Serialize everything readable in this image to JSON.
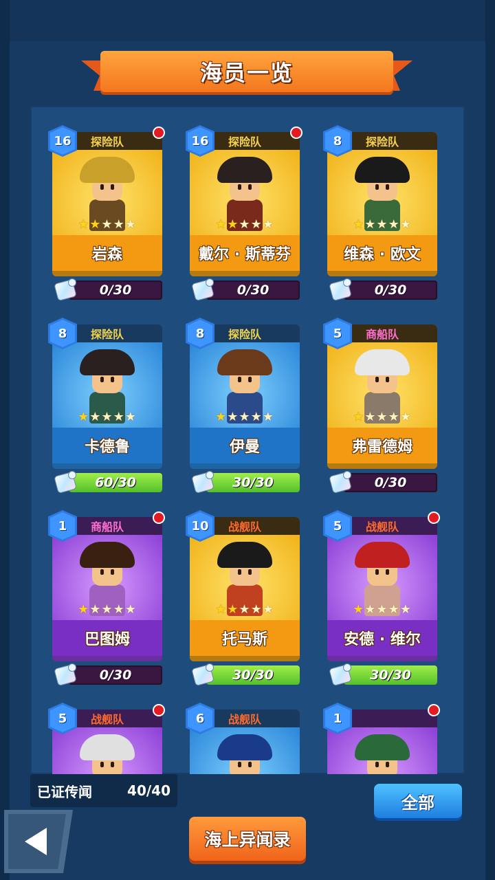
{
  "title": "海员一览",
  "crew": [
    {
      "level": "16",
      "team": "探险队",
      "team_type": "explore",
      "name": "岩森",
      "stars": 2,
      "progress_text": "0/30",
      "progress": 0,
      "color": "orange",
      "alert": true,
      "hat": "#c9a02a",
      "body": "#6a4a20"
    },
    {
      "level": "16",
      "team": "探险队",
      "team_type": "explore",
      "name": "戴尔 · 斯蒂芬",
      "stars": 2,
      "progress_text": "0/30",
      "progress": 0,
      "color": "orange",
      "alert": true,
      "hat": "#2a2020",
      "body": "#7a2a1a"
    },
    {
      "level": "8",
      "team": "探险队",
      "team_type": "explore",
      "name": "维森 · 欧文",
      "stars": 1,
      "progress_text": "0/30",
      "progress": 0,
      "color": "orange",
      "alert": false,
      "hat": "#1a1a1a",
      "body": "#3a6a3a"
    },
    {
      "level": "8",
      "team": "探险队",
      "team_type": "explore",
      "name": "卡德鲁",
      "stars": 1,
      "progress_text": "60/30",
      "progress": 1,
      "color": "blue",
      "alert": false,
      "hat": "#2a2020",
      "body": "#2a5a4a"
    },
    {
      "level": "8",
      "team": "探险队",
      "team_type": "explore",
      "name": "伊曼",
      "stars": 1,
      "progress_text": "30/30",
      "progress": 1,
      "color": "blue",
      "alert": false,
      "hat": "#6a3a1a",
      "body": "#2a4a8a"
    },
    {
      "level": "5",
      "team": "商船队",
      "team_type": "ship",
      "name": "弗雷德姆",
      "stars": 1,
      "progress_text": "0/30",
      "progress": 0,
      "color": "orange",
      "alert": false,
      "hat": "#e8e8e8",
      "body": "#8a7a6a"
    },
    {
      "level": "1",
      "team": "商船队",
      "team_type": "ship",
      "name": "巴图姆",
      "stars": 1,
      "progress_text": "0/30",
      "progress": 0,
      "color": "purple",
      "alert": true,
      "hat": "#3a2010",
      "body": "#a060c0"
    },
    {
      "level": "10",
      "team": "战舰队",
      "team_type": "war",
      "name": "托马斯",
      "stars": 2,
      "progress_text": "30/30",
      "progress": 1,
      "color": "orange",
      "alert": false,
      "hat": "#1a1a1a",
      "body": "#c04020"
    },
    {
      "level": "5",
      "team": "战舰队",
      "team_type": "war",
      "name": "安德 · 维尔",
      "stars": 1,
      "progress_text": "30/30",
      "progress": 1,
      "color": "purple",
      "alert": true,
      "hat": "#c02020",
      "body": "#d0a090"
    },
    {
      "level": "5",
      "team": "战舰队",
      "team_type": "war",
      "name": "",
      "stars": 0,
      "progress_text": "",
      "progress": 0,
      "color": "purple",
      "alert": true,
      "hat": "#e0e0e0",
      "body": "#6a8a3a"
    },
    {
      "level": "6",
      "team": "战舰队",
      "team_type": "war",
      "name": "",
      "stars": 0,
      "progress_text": "",
      "progress": 0,
      "color": "blue",
      "alert": false,
      "hat": "#1a3a8a",
      "body": "#5a3a2a"
    },
    {
      "level": "1",
      "team": "",
      "team_type": "",
      "name": "",
      "stars": 0,
      "progress_text": "",
      "progress": 0,
      "color": "purple",
      "alert": true,
      "hat": "#2a6a3a",
      "body": "#3a2a1a"
    }
  ],
  "footer": {
    "found_label": "已证传闻",
    "found_count": "40/40",
    "all_button": "全部",
    "tales_button": "海上异闻录"
  },
  "icons": {
    "back": "back-arrow-icon",
    "puzzle": "puzzle-piece-icon",
    "alert": "notification-dot-icon"
  }
}
